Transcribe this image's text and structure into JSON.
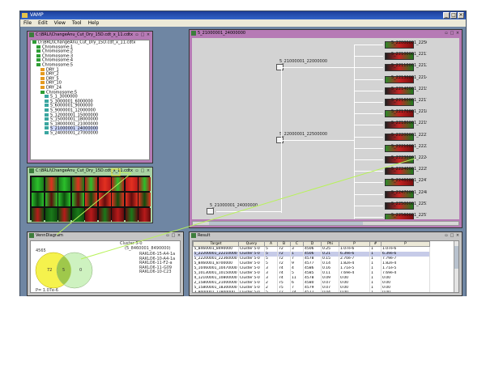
{
  "app": {
    "title": "VAMP",
    "menu": [
      "File",
      "Edit",
      "View",
      "Tool",
      "Help"
    ],
    "window_buttons": [
      "_",
      "□",
      "×"
    ]
  },
  "tree_panel": {
    "title": "C:\\BRLl\\ChangeAnu_Cut_Dry_15D.cdt_x_11.cdtx",
    "items": [
      {
        "label": "D:\\BRLl\\ChangeAnu_Cut_Dry_15D.cdt_x_11.cdtx",
        "indent": 0,
        "color": "g"
      },
      {
        "label": "Chromosome:1",
        "indent": 1,
        "color": "g"
      },
      {
        "label": "Chromosome:2",
        "indent": 1,
        "color": "g"
      },
      {
        "label": "Chromosome:3",
        "indent": 1,
        "color": "g"
      },
      {
        "label": "Chromosome:4",
        "indent": 1,
        "color": "g"
      },
      {
        "label": "Chromosome:5",
        "indent": 1,
        "color": "g"
      },
      {
        "label": "DRY_1",
        "indent": 2,
        "color": "o"
      },
      {
        "label": "DRY_2",
        "indent": 2,
        "color": "o"
      },
      {
        "label": "DRY_5",
        "indent": 2,
        "color": "o"
      },
      {
        "label": "DRY_10",
        "indent": 2,
        "color": "o"
      },
      {
        "label": "DRY_24",
        "indent": 2,
        "color": "o"
      },
      {
        "label": "Chromosome:5",
        "indent": 2,
        "color": "g"
      },
      {
        "label": "5_1_3000000",
        "indent": 3,
        "color": "m"
      },
      {
        "label": "5_3000001_6000000",
        "indent": 3,
        "color": "m"
      },
      {
        "label": "5_6000001_9000000",
        "indent": 3,
        "color": "m"
      },
      {
        "label": "5_9000001_12000000",
        "indent": 3,
        "color": "m"
      },
      {
        "label": "5_12000001_15000000",
        "indent": 3,
        "color": "m"
      },
      {
        "label": "5_15000001_18000000",
        "indent": 3,
        "color": "m"
      },
      {
        "label": "5_18000001_21000000",
        "indent": 3,
        "color": "m"
      },
      {
        "label": "5_21000001_24000000",
        "indent": 3,
        "color": "m",
        "selected": true
      },
      {
        "label": "5_24000001_27000000",
        "indent": 3,
        "color": "m"
      }
    ]
  },
  "heat_panel": {
    "title": "C:\\BRLl\\ChangeAnu_Cut_Dry_15D.cdt_x_11.cdtx"
  },
  "big_panel": {
    "title": "5_21000001_24000000",
    "nodes": [
      {
        "label": "5_21000001_22000000"
      },
      {
        "label": "5_22000001_22500000"
      },
      {
        "label": "5_21000001_24000000"
      }
    ],
    "thumb_labels": [
      "5_22000001_22500000",
      "5_22100001_22110000",
      "5_22110001_22120000",
      "5_22130001_22140000",
      "5_22140001_22150000",
      "5_22160001_22170000",
      "5_22170001_22180000",
      "5_22180001_22190000",
      "5_22200001_22210000",
      "5_22210001_22220000",
      "5_22230001_22240000",
      "5_22240001_22250000",
      "5_22460001_22470000",
      "5_22470001_22480000",
      "5_22500001_22510000",
      "5_22560001_22570000"
    ]
  },
  "venn_panel": {
    "title": "VennDiagram",
    "left_count": "4565",
    "left_value": "72",
    "middle_value": "5",
    "right_value": "0",
    "cluster_label": "Cluster 5-0",
    "range_label": "(5_8460001_8490000)",
    "gene_list": [
      "RAKLO6-15-A4-1a",
      "RAKLO6-10-A4-1a",
      "RAKLO6-11-F2-a",
      "RAKLO6-11-G09",
      "RAKLO6-10-C23"
    ],
    "pvalue": "P= 1.07e-6"
  },
  "result_panel": {
    "title": "Result",
    "columns": [
      "Target",
      "Query",
      "A",
      "B",
      "C",
      "D",
      "Phi",
      "P",
      "#",
      "P"
    ],
    "rows": [
      [
        "5_8460001_8490000",
        "Cluster 5-0",
        "5",
        "72",
        "3",
        "4506",
        "0.25",
        "1.07e-6",
        "1",
        "1.07e-6"
      ],
      [
        "5_22200001_22210000",
        "Cluster 5-0",
        "5",
        "72",
        "1",
        "4506",
        "0.21",
        "6.39e-6",
        "1",
        "6.39e-6"
      ],
      [
        "5_22200001_22360000",
        "Cluster 5-0",
        "5",
        "72",
        "7",
        "4578",
        "0.15",
        "2.70e-7",
        "1",
        "7.79e-7"
      ],
      [
        "5_8460001_8700000",
        "Cluster 5-0",
        "5",
        "72",
        "9",
        "4577",
        "0.14",
        "1.82e-4",
        "1",
        "1.82e-4"
      ],
      [
        "5_10460001_10470000",
        "Cluster 5-0",
        "3",
        "74",
        "4",
        "4586",
        "0.16",
        "1.71e-5",
        "1",
        "1.71e-5"
      ],
      [
        "5_10130001_10150000",
        "Cluster 5-0",
        "3",
        "74",
        "5",
        "4585",
        "0.11",
        "7.69e-4",
        "1",
        "7.69e-4"
      ],
      [
        "4_12100001_10800000",
        "Cluster 5-0",
        "3",
        "74",
        "11",
        "4578",
        "0.09",
        "0.00",
        "1",
        "0.00"
      ],
      [
        "2_15800001_21000000",
        "Cluster 5-0",
        "2",
        "75",
        "6",
        "4580",
        "0.07",
        "0.00",
        "1",
        "0.00"
      ],
      [
        "5_15800001_18300000",
        "Cluster 5-0",
        "2",
        "75",
        "7",
        "4579",
        "0.07",
        "0.00",
        "1",
        "0.00"
      ],
      [
        "3_8000001_12800000",
        "Cluster 5-0",
        "5",
        "72",
        "74",
        "4512",
        "0.04",
        "0.00",
        "1",
        "0.00"
      ],
      [
        "5_9670001_10000000",
        "Cluster 5-0",
        "2",
        "75",
        "9",
        "4580",
        "0.11",
        "0.01",
        "1",
        "0.01"
      ],
      [
        "2_10050001_11000000",
        "Cluster 5-0",
        "2",
        "75",
        "9",
        "4580",
        "0.11",
        "0.01",
        "1",
        "0.01"
      ]
    ],
    "selected_row": 1
  },
  "colors": {
    "tree_border": "#b67ab5",
    "heat_border": "#a9d3a3",
    "connector": "#b8f25a",
    "venn_left": "#f5f24d",
    "venn_right": "#c6f0b5"
  }
}
